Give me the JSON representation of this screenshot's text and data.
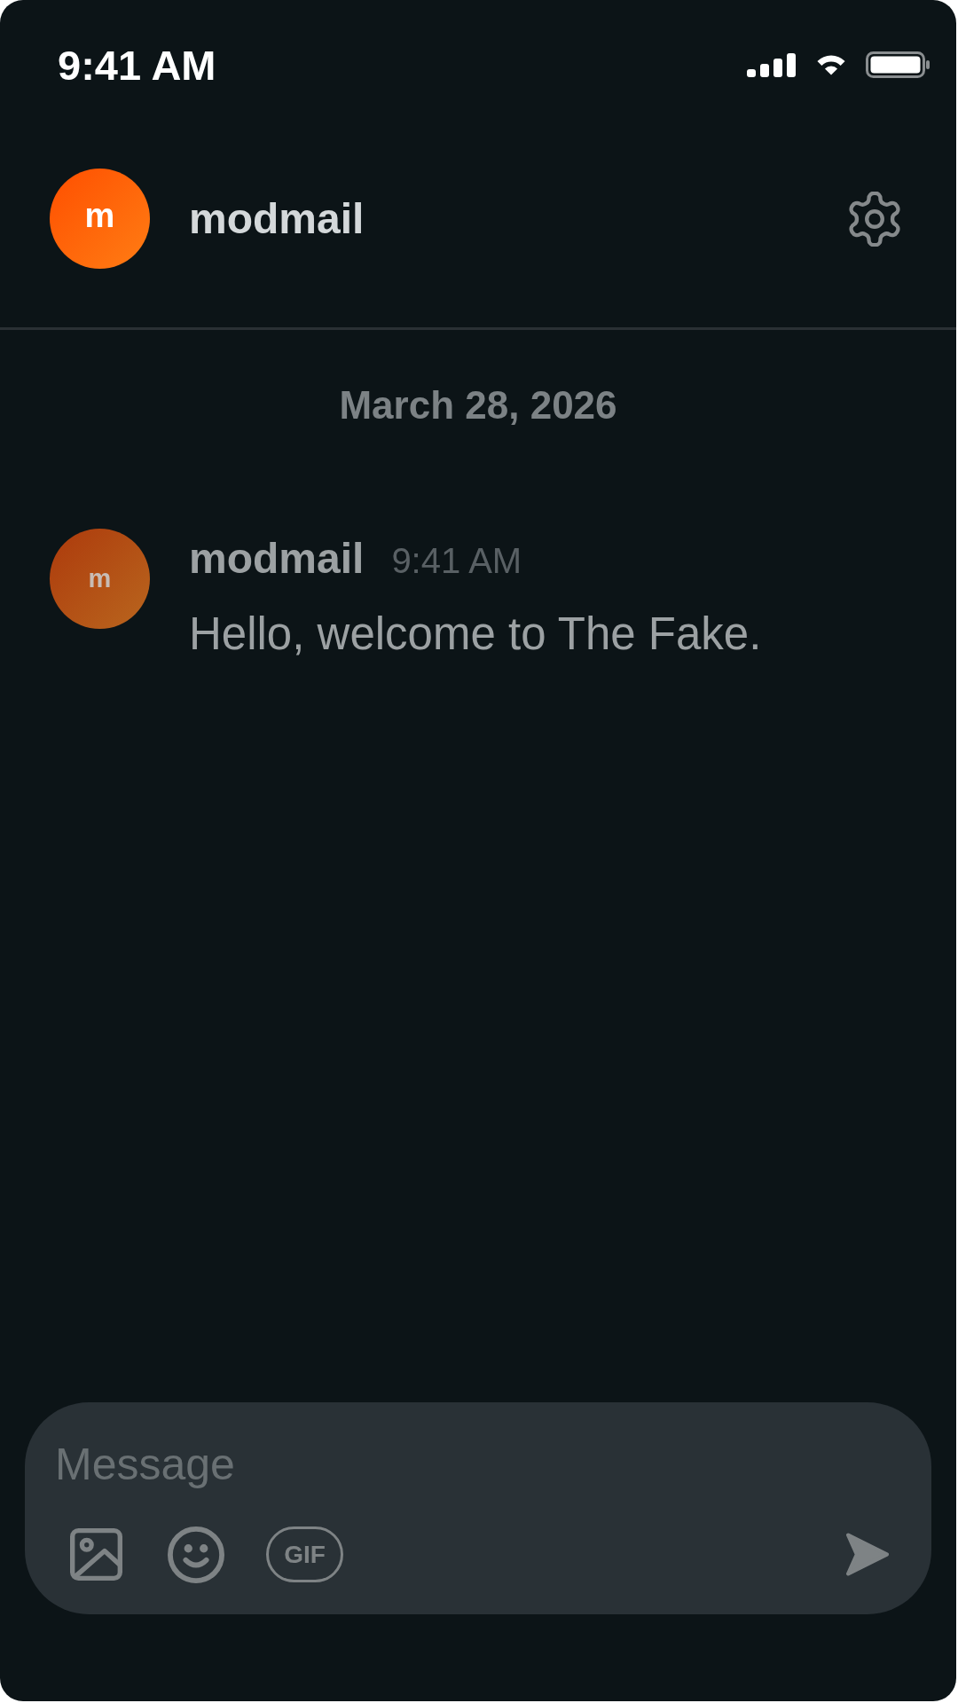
{
  "status_bar": {
    "time": "9:41 AM"
  },
  "header": {
    "avatar_letter": "m",
    "title": "modmail"
  },
  "date_separator": "March 28, 2026",
  "messages": [
    {
      "avatar_letter": "m",
      "author": "modmail",
      "time": "9:41 AM",
      "text": "Hello, welcome to The Fake."
    }
  ],
  "composer": {
    "placeholder": "Message",
    "gif_label": "GIF"
  }
}
